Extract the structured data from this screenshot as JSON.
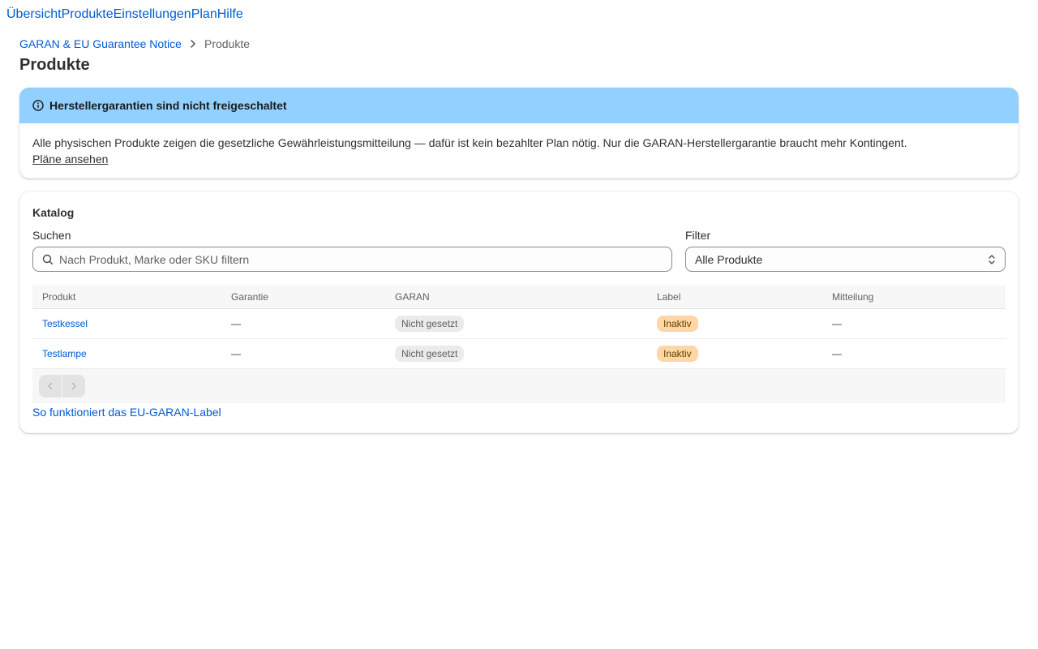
{
  "nav": {
    "items": [
      {
        "label": "Übersicht"
      },
      {
        "label": "Produkte"
      },
      {
        "label": "Einstellungen"
      },
      {
        "label": "Plan"
      },
      {
        "label": "Hilfe"
      }
    ]
  },
  "breadcrumb": {
    "parent": "GARAN & EU Guarantee Notice",
    "current": "Produkte"
  },
  "page": {
    "title": "Produkte"
  },
  "banner": {
    "title": "Herstellergarantien sind nicht freigeschaltet",
    "body": "Alle physischen Produkte zeigen die gesetzliche Gewährleistungsmitteilung — dafür ist kein bezahlter Plan nötig. Nur die GARAN-Herstellergarantie braucht mehr Kontingent.",
    "link": "Pläne ansehen",
    "color": "#91d0ff"
  },
  "catalog": {
    "title": "Katalog",
    "search_label": "Suchen",
    "search_placeholder": "Nach Produkt, Marke oder SKU filtern",
    "search_value": "",
    "filter_label": "Filter",
    "filter_value": "Alle Produkte",
    "columns": {
      "product": "Produkt",
      "guarantee": "Garantie",
      "garan": "GARAN",
      "label": "Label",
      "notice": "Mitteilung"
    },
    "rows": [
      {
        "product": "Testkessel",
        "guarantee": "—",
        "garan": "Nicht gesetzt",
        "label": "Inaktiv",
        "notice": "—"
      },
      {
        "product": "Testlampe",
        "guarantee": "—",
        "garan": "Nicht gesetzt",
        "label": "Inaktiv",
        "notice": "—"
      }
    ],
    "help_link": "So funktioniert das EU-GARAN-Label"
  },
  "colors": {
    "link": "#005bd3",
    "badge_warning": "#ffd6a4",
    "badge_neutral": "#ebebeb"
  }
}
